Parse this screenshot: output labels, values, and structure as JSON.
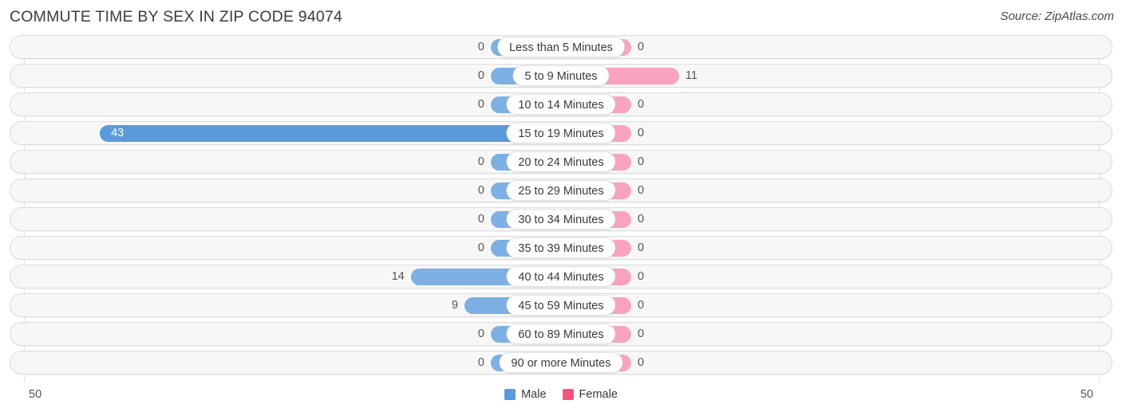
{
  "header": {
    "title": "COMMUTE TIME BY SEX IN ZIP CODE 94074",
    "source": "Source: ZipAtlas.com"
  },
  "axis": {
    "left_label": "50",
    "right_label": "50",
    "max": 50
  },
  "legend": {
    "items": [
      {
        "label": "Male",
        "color": "#5b9bd9"
      },
      {
        "label": "Female",
        "color": "#f2567f"
      }
    ]
  },
  "colors": {
    "male_light": "#7eb0e3",
    "male_dark": "#5b9bd9",
    "female_light": "#f9a3c0",
    "female_dark": "#f2567f",
    "track": "#f7f7f7",
    "track_border": "#dcdcdc"
  },
  "chart_data": {
    "type": "bar",
    "title": "COMMUTE TIME BY SEX IN ZIP CODE 94074",
    "subtitle": "Source: ZipAtlas.com",
    "orientation": "horizontal-diverging",
    "xlabel": "",
    "ylabel": "",
    "xlim": [
      -50,
      50
    ],
    "grid": false,
    "legend_position": "bottom-center",
    "categories": [
      "Less than 5 Minutes",
      "5 to 9 Minutes",
      "10 to 14 Minutes",
      "15 to 19 Minutes",
      "20 to 24 Minutes",
      "25 to 29 Minutes",
      "30 to 34 Minutes",
      "35 to 39 Minutes",
      "40 to 44 Minutes",
      "45 to 59 Minutes",
      "60 to 89 Minutes",
      "90 or more Minutes"
    ],
    "series": [
      {
        "name": "Male",
        "color": "#5b9bd9",
        "values": [
          0,
          0,
          0,
          43,
          0,
          0,
          0,
          0,
          14,
          9,
          0,
          0
        ]
      },
      {
        "name": "Female",
        "color": "#f2567f",
        "values": [
          0,
          11,
          0,
          0,
          0,
          0,
          0,
          0,
          0,
          0,
          0,
          0
        ]
      }
    ]
  }
}
